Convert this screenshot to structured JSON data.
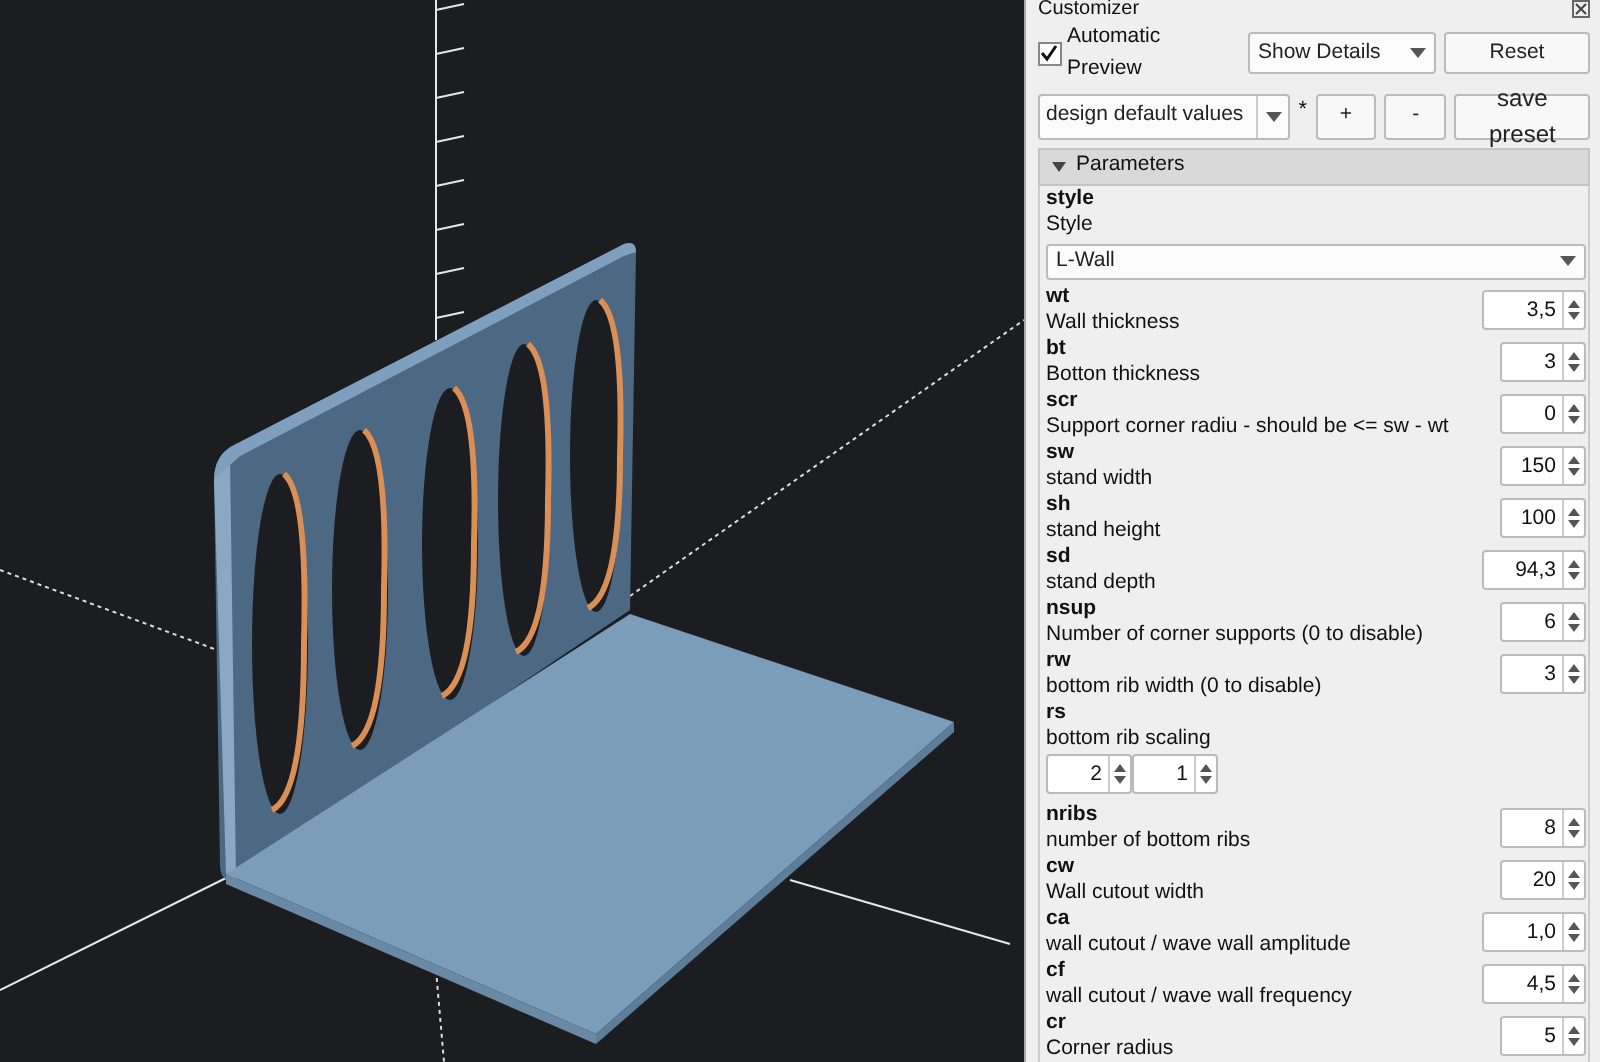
{
  "window": {
    "title": "Customizer"
  },
  "toolbar": {
    "automatic_preview": {
      "label": "Automatic Preview",
      "checked": true
    },
    "details_select": {
      "value": "Show Details"
    },
    "reset_button": "Reset",
    "preset_select": {
      "value": "design default values"
    },
    "modified_mark": "*",
    "add_button": "+",
    "remove_button": "-",
    "save_button": "save preset"
  },
  "section": {
    "title": "Parameters",
    "expanded": true
  },
  "parameters": [
    {
      "kind": "select",
      "name": "style",
      "description": "Style",
      "value": "L-Wall"
    },
    {
      "kind": "spin",
      "name": "wt",
      "description": "Wall thickness",
      "value": "3,5"
    },
    {
      "kind": "spin",
      "name": "bt",
      "description": "Botton thickness",
      "value": "3"
    },
    {
      "kind": "spin",
      "name": "scr",
      "description": "Support corner radiu - should be <= sw - wt",
      "value": "0"
    },
    {
      "kind": "spin",
      "name": "sw",
      "description": "stand width",
      "value": "150"
    },
    {
      "kind": "spin",
      "name": "sh",
      "description": "stand height",
      "value": "100"
    },
    {
      "kind": "spin",
      "name": "sd",
      "description": "stand depth",
      "value": "94,3"
    },
    {
      "kind": "spin",
      "name": "nsup",
      "description": "Number of corner supports (0 to disable)",
      "value": "6"
    },
    {
      "kind": "spin",
      "name": "rw",
      "description": "bottom rib width (0 to disable)",
      "value": "3"
    },
    {
      "kind": "vector",
      "name": "rs",
      "description": "bottom rib scaling",
      "values": [
        "2",
        "1"
      ]
    },
    {
      "kind": "spin",
      "name": "nribs",
      "description": "number of bottom ribs",
      "value": "8"
    },
    {
      "kind": "spin",
      "name": "cw",
      "description": "Wall cutout width",
      "value": "20"
    },
    {
      "kind": "spin",
      "name": "ca",
      "description": "wall cutout / wave wall amplitude",
      "value": "1,0"
    },
    {
      "kind": "spin",
      "name": "cf",
      "description": "wall cutout / wave wall frequency",
      "value": "4,5"
    },
    {
      "kind": "spin",
      "name": "cr",
      "description": "Corner radius",
      "value": "5"
    }
  ]
}
